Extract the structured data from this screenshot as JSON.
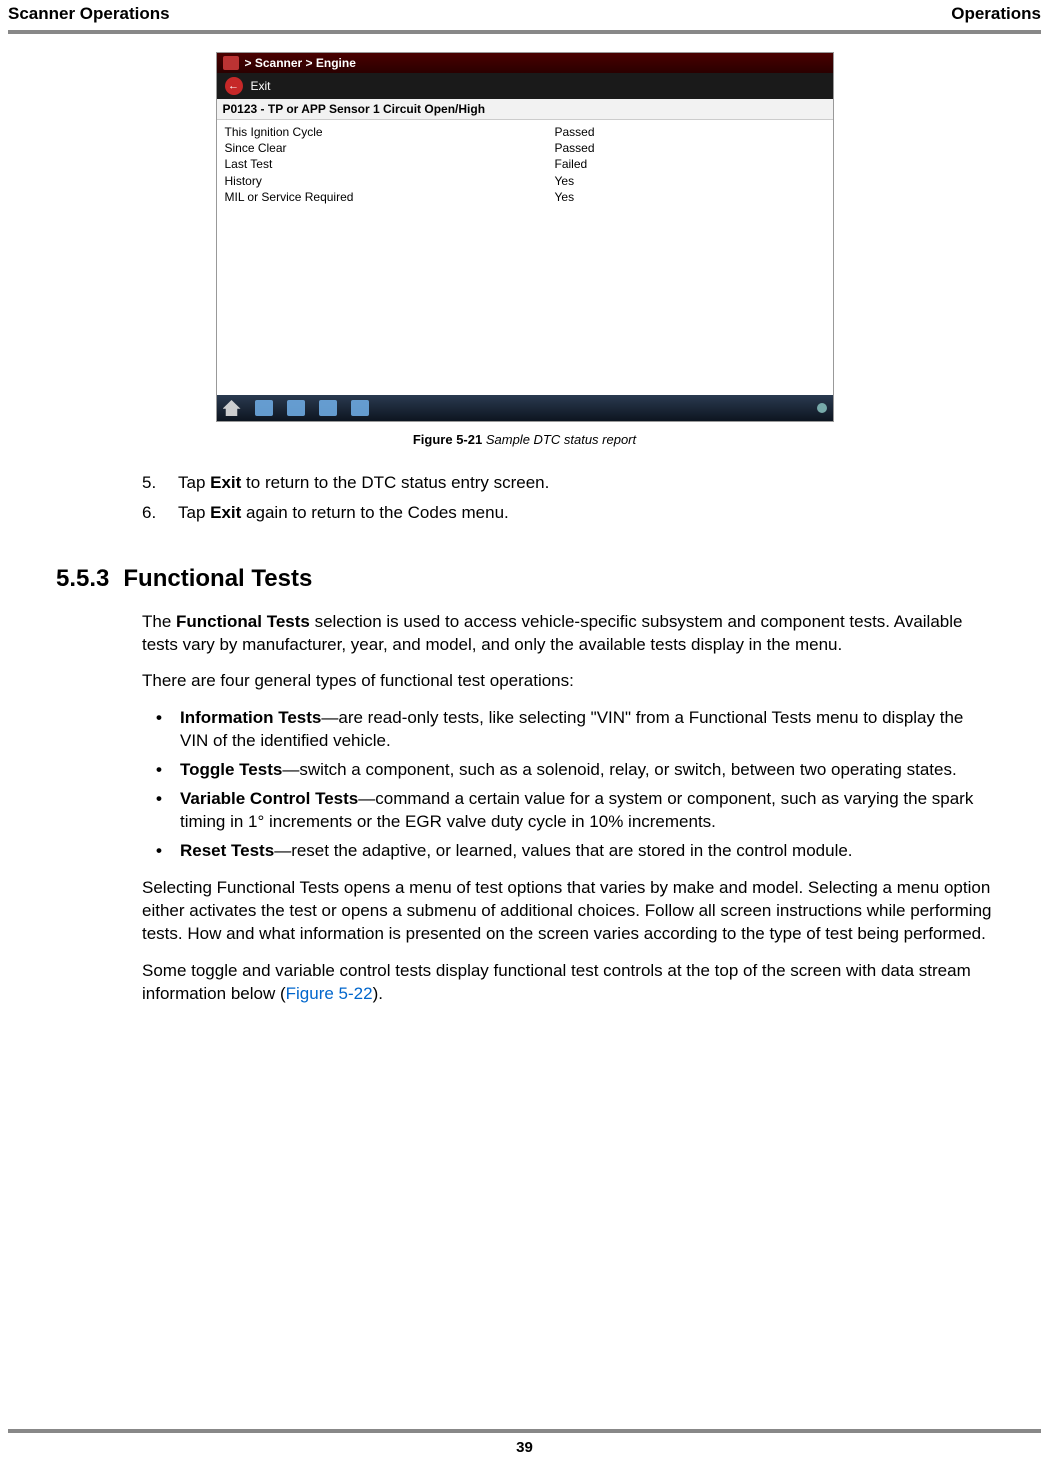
{
  "header": {
    "left": "Scanner Operations",
    "right": "Operations"
  },
  "screenshot": {
    "breadcrumb": "> Scanner  > Engine",
    "exit_label": "Exit",
    "dtc_title": "P0123   -   TP or APP Sensor 1 Circuit Open/High",
    "rows": [
      {
        "k": "This Ignition Cycle",
        "v": "Passed"
      },
      {
        "k": "Since Clear",
        "v": "Passed"
      },
      {
        "k": "Last Test",
        "v": "Failed"
      },
      {
        "k": "History",
        "v": "Yes"
      },
      {
        "k": "MIL or Service Required",
        "v": "Yes"
      }
    ]
  },
  "figure": {
    "label": "Figure 5-21",
    "caption": "Sample DTC status report"
  },
  "steps": [
    {
      "num": "5.",
      "pre": "Tap ",
      "bold": "Exit",
      "post": " to return to the DTC status entry screen."
    },
    {
      "num": "6.",
      "pre": "Tap ",
      "bold": "Exit",
      "post": " again to return to the Codes menu."
    }
  ],
  "section": {
    "num": "5.5.3",
    "title": "Functional Tests"
  },
  "para1_pre": "The ",
  "para1_bold": "Functional Tests",
  "para1_post": " selection is used to access vehicle-specific subsystem and component tests. Available tests vary by manufacturer, year, and model, and only the available tests display in the menu.",
  "para2": "There are four general types of functional test operations:",
  "bullets": [
    {
      "bold": "Information Tests",
      "rest": "—are read-only tests, like selecting \"VIN\" from a Functional Tests menu to display the VIN of the identified vehicle."
    },
    {
      "bold": "Toggle Tests",
      "rest": "—switch a component, such as a solenoid, relay, or switch, between two operating states."
    },
    {
      "bold": "Variable Control Tests",
      "rest": "—command a certain value for a system or component, such as varying the spark timing in 1° increments or the EGR valve duty cycle in 10% increments."
    },
    {
      "bold": "Reset Tests",
      "rest": "—reset the adaptive, or learned, values that are stored in the control module."
    }
  ],
  "para3": "Selecting Functional Tests opens a menu of test options that varies by make and model. Selecting a menu option either activates the test or opens a submenu of additional choices. Follow all screen instructions while performing tests. How and what information is presented on the screen varies according to the type of test being performed.",
  "para4_pre": "Some toggle and variable control tests display functional test controls at the top of the screen with data stream information below (",
  "para4_link": "Figure 5-22",
  "para4_post": ").",
  "page_number": "39"
}
